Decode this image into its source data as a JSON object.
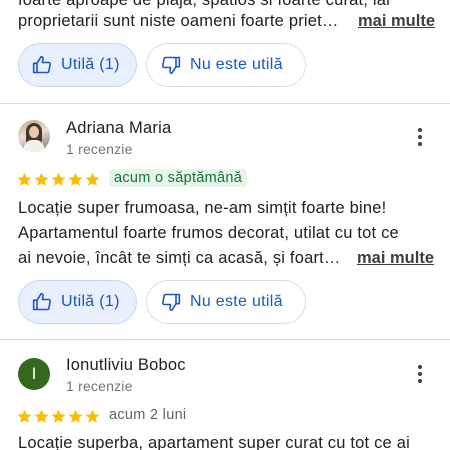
{
  "review_top": {
    "text_lines": [
      "foarte aproape de plaja, spatios si foarte curat, iar",
      "proprietarii sunt niste oameni foarte priet…"
    ],
    "more_label": "mai multe",
    "helpful_label": "Utilă (1)",
    "not_helpful_label": "Nu este utilă"
  },
  "review_adriana": {
    "name": "Adriana Maria",
    "subtitle": "1 recenzie",
    "rating": 5,
    "time": "acum o săptămână",
    "text_lines": [
      "Locație super frumoasa, ne-am simțit foarte bine!",
      "Apartamentul foarte frumos decorat, utilat cu tot ce",
      "ai nevoie, încât te simți ca acasă, și foart…"
    ],
    "more_label": "mai multe",
    "helpful_label": "Utilă (1)",
    "not_helpful_label": "Nu este utilă"
  },
  "review_ionut": {
    "avatar_letter": "I",
    "name": "Ionutliviu Boboc",
    "subtitle": "1 recenzie",
    "rating": 5,
    "time": "acum 2 luni",
    "text_lines": [
      "Locație superba, apartament super curat cu tot ce ai"
    ]
  },
  "colors": {
    "star": "#fbbc04",
    "link_blue": "#1a56c4",
    "avatar_green": "#33691e"
  },
  "icons": {
    "thumbs_up": "thumbs-up-icon",
    "thumbs_down": "thumbs-down-icon",
    "more_options": "more-vert-icon",
    "star": "star-icon"
  }
}
